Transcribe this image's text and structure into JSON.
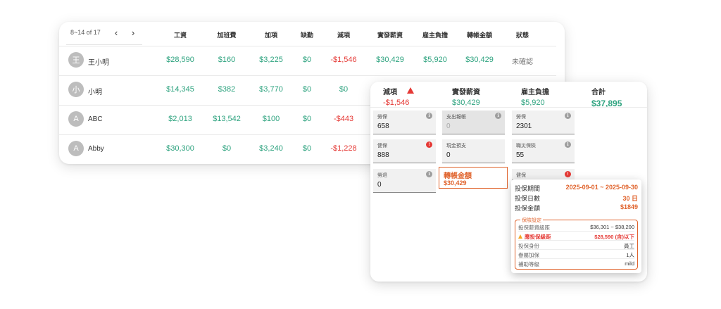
{
  "table": {
    "pager": "8~14 of 17",
    "headers": [
      "工資",
      "加班費",
      "加項",
      "缺勤",
      "減項",
      "實發薪資",
      "雇主負擔",
      "轉帳金額",
      "狀態"
    ],
    "rows": [
      {
        "avatar": "王",
        "name": "王小明",
        "cells": [
          "$28,590",
          "$160",
          "$3,225",
          "$0",
          "-$1,546",
          "$30,429",
          "$5,920",
          "$30,429",
          "未確認"
        ]
      },
      {
        "avatar": "小",
        "name": "小明",
        "cells": [
          "$14,345",
          "$382",
          "$3,770",
          "$0",
          "$0",
          "",
          "",
          "",
          ""
        ]
      },
      {
        "avatar": "A",
        "name": "ABC",
        "cells": [
          "$2,013",
          "$13,542",
          "$100",
          "$0",
          "-$443",
          "",
          "",
          "",
          ""
        ]
      },
      {
        "avatar": "A",
        "name": "Abby",
        "cells": [
          "$30,300",
          "$0",
          "$3,240",
          "$0",
          "-$1,228",
          "",
          "",
          "",
          ""
        ]
      }
    ]
  },
  "detail": {
    "summary": [
      {
        "label": "減項",
        "value": "-$1,546"
      },
      {
        "label": "實發薪資",
        "value": "$30,429"
      },
      {
        "label": "雇主負擔",
        "value": "$5,920"
      },
      {
        "label": "合計",
        "value": "$37,895"
      }
    ],
    "fields": {
      "labor_ins": {
        "label": "勞保",
        "value": "658"
      },
      "expense": {
        "label": "支出報帳",
        "value": "0"
      },
      "labor_ins_emp": {
        "label": "勞保",
        "value": "2301"
      },
      "health": {
        "label": "健保",
        "value": "888"
      },
      "cash_advance": {
        "label": "現金預支",
        "value": "0"
      },
      "occupational": {
        "label": "職災保險",
        "value": "55"
      },
      "pension": {
        "label": "勞退",
        "value": "0"
      },
      "health_emp": {
        "label": "健保"
      }
    },
    "transfer": {
      "label": "轉帳金額",
      "value": "$30,429"
    },
    "tooltip": {
      "period_label": "投保期間",
      "period_value": "2025-09-01 ~ 2025-09-30",
      "days_label": "投保日數",
      "days_value": "30 日",
      "amount_label": "投保金額",
      "amount_value": "$1849",
      "box_title": "保險設定",
      "salary_range_label": "投保薪資級距",
      "salary_range_value": "$36,301 ~ $38,200",
      "should_label": "應投保級距",
      "should_value": "$28,590 (含)以下",
      "identity_label": "投保身份",
      "identity_value": "員工",
      "dependents_label": "眷屬加保",
      "dependents_value": "1人",
      "subsidy_label": "補助等級",
      "subsidy_value": "mild"
    }
  },
  "colors": {
    "positive": "#2ea37f",
    "negative": "#e53935",
    "accent": "#e0632c"
  }
}
